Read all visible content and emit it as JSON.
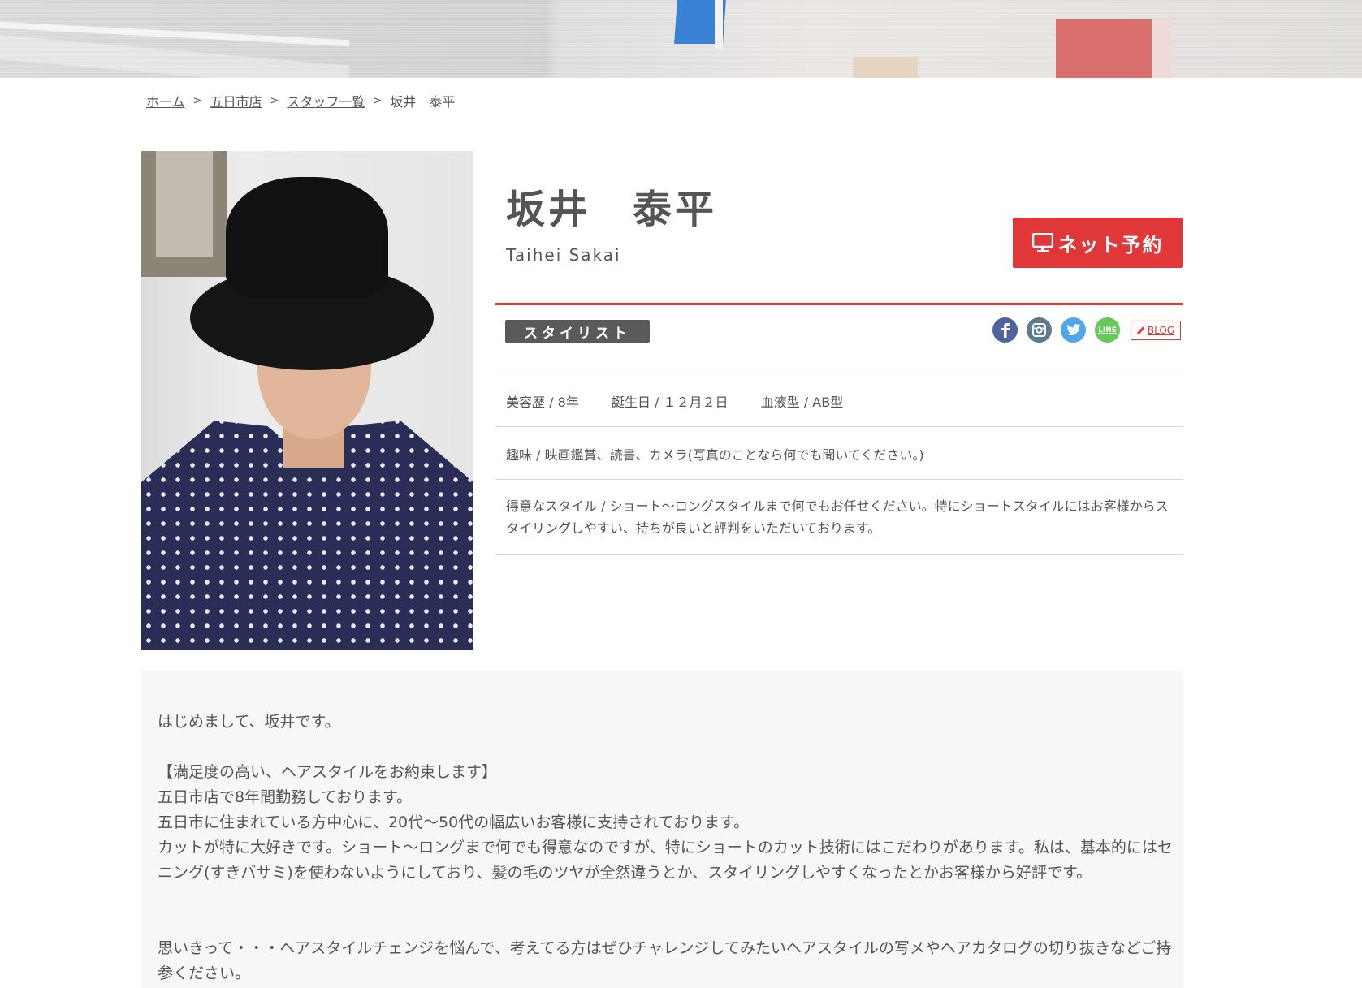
{
  "breadcrumb": {
    "home": "ホーム",
    "store": "五日市店",
    "staff_list": "スタッフ一覧",
    "current": "坂井　泰平",
    "separator": ">"
  },
  "profile": {
    "name": "坂井　泰平",
    "romaji": "Taihei Sakai",
    "reserve_label": "ネット予約",
    "role": "スタイリスト",
    "blog_label": "BLOG",
    "line_label": "LINE",
    "career": "美容歴 / 8年",
    "birthday": "誕生日 / １２月２日",
    "blood": "血液型 / AB型",
    "hobby": "趣味 / 映画鑑賞、読書、カメラ(写真のことなら何でも聞いてください。)",
    "specialty": "得意なスタイル / ショート～ロングスタイルまで何でもお任せください。特にショートスタイルにはお客様からスタイリングしやすい、持ちが良いと評判をいただいております。"
  },
  "message": {
    "greeting": "はじめまして、坂井です。",
    "heading": "【満足度の高い、ヘアスタイルをお約束します】",
    "line1": "五日市店で8年間勤務しております。",
    "line2": "五日市に住まれている方中心に、20代～50代の幅広いお客様に支持されております。",
    "line3": "カットが特に大好きです。ショート～ロングまで何でも得意なのですが、特にショートのカット技術にはこだわりがあります。私は、基本的にはセニング(すきバサミ)を使わないようにしており、髪の毛のツヤが全然違うとか、スタイリングしやすくなったとかお客様から好評です。",
    "line4": "思いきって・・・ヘアスタイルチェンジを悩んで、考えてる方はぜひチャレンジしてみたいヘアスタイルの写メやヘアカタログの切り抜きなどご持参ください。"
  },
  "colors": {
    "accent": "#e03838",
    "badge": "#5a5a5a",
    "facebook": "#4f649e",
    "instagram": "#5d7b8e",
    "twitter": "#4fa6e8",
    "line": "#67c85a"
  }
}
